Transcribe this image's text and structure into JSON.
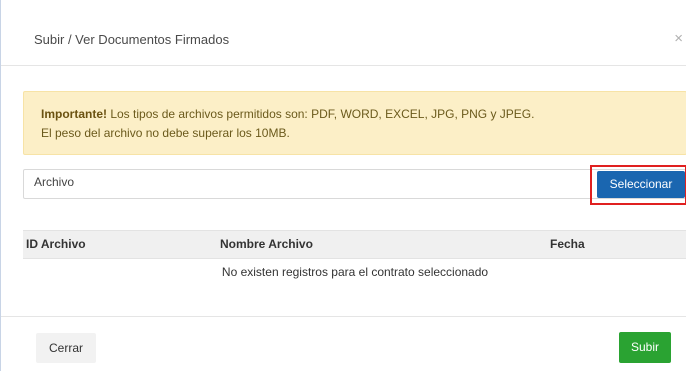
{
  "modal": {
    "title": "Subir / Ver Documentos Firmados",
    "close_glyph": "×"
  },
  "alert": {
    "strong": "Importante!",
    "line1": " Los tipos de archivos permitidos son: PDF, WORD, EXCEL, JPG, PNG y JPEG.",
    "line2": "El peso del archivo no debe superar los 10MB."
  },
  "file_input": {
    "label": "Archivo",
    "select_label": "Seleccionar"
  },
  "table": {
    "headers": [
      "ID Archivo",
      "Nombre Archivo",
      "Fecha"
    ],
    "empty_message": "No existen registros para el contrato seleccionado"
  },
  "footer": {
    "close_label": "Cerrar",
    "upload_label": "Subir"
  },
  "colors": {
    "primary": "#1a66b0",
    "success": "#2aa332",
    "highlight": "#e02020",
    "alert_bg": "#fcefc7"
  }
}
